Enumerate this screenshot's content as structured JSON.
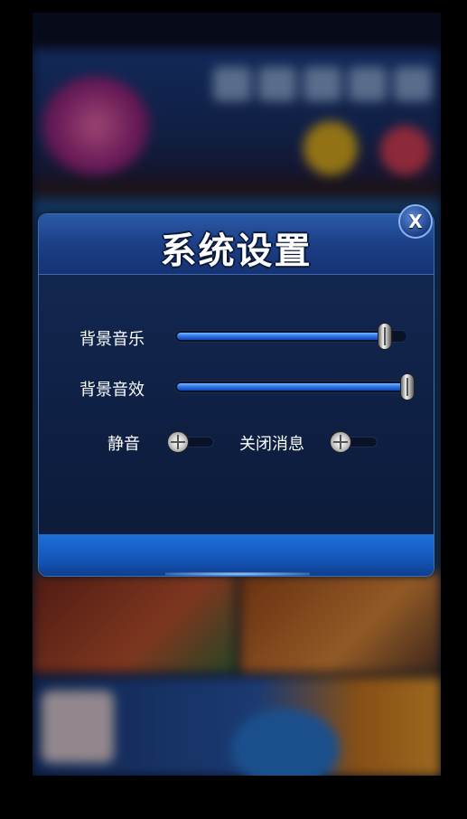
{
  "dialog": {
    "title": "系统设置",
    "close_label": "X"
  },
  "settings": {
    "bg_music": {
      "label": "背景音乐",
      "value": 0.93
    },
    "bg_sfx": {
      "label": "背景音效",
      "value": 1.0
    },
    "mute": {
      "label": "静音",
      "on": false
    },
    "close_messages": {
      "label": "关闭消息",
      "on": false
    }
  },
  "colors": {
    "accent_blue": "#2f78e8",
    "dialog_bg": "#0e1f42",
    "header_bg": "#1c3f86"
  }
}
